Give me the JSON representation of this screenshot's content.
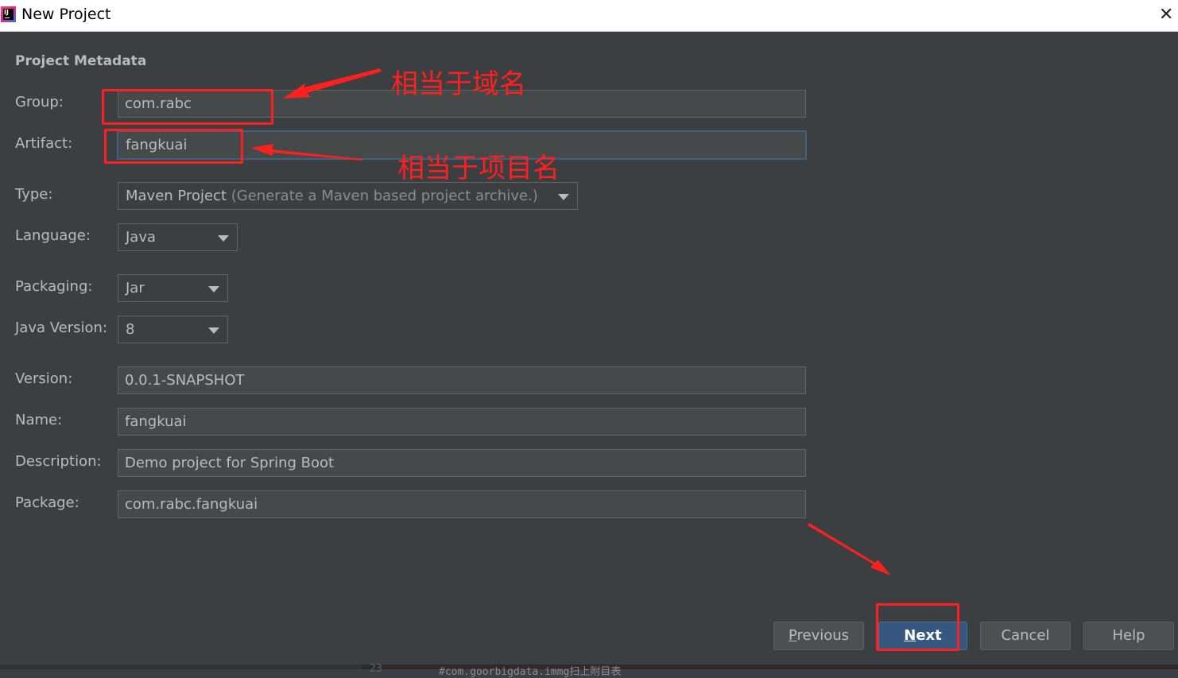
{
  "window": {
    "title": "New Project",
    "close_glyph": "✕",
    "app_icon": "intellij-idea-icon",
    "app_icon_letters": "IJ"
  },
  "section_title": "Project Metadata",
  "fields": {
    "group": {
      "label": "Group:",
      "value": "com.rabc"
    },
    "artifact": {
      "label": "Artifact:",
      "value": "fangkuai"
    },
    "type": {
      "label": "Type:",
      "value": "Maven Project",
      "description": "(Generate a Maven based project archive.)"
    },
    "language": {
      "label": "Language:",
      "value": "Java"
    },
    "packaging": {
      "label": "Packaging:",
      "value": "Jar"
    },
    "java_version": {
      "label": "Java Version:",
      "value": "8"
    },
    "version": {
      "label": "Version:",
      "value": "0.0.1-SNAPSHOT"
    },
    "name": {
      "label": "Name:",
      "value": "fangkuai"
    },
    "description": {
      "label": "Description:",
      "value": "Demo project for Spring Boot"
    },
    "package": {
      "label": "Package:",
      "value": "com.rabc.fangkuai"
    }
  },
  "buttons": {
    "previous": {
      "mnemonic": "P",
      "rest": "revious"
    },
    "next": {
      "mnemonic": "N",
      "rest": "ext"
    },
    "cancel": "Cancel",
    "help": "Help"
  },
  "annotations": {
    "group_note": "相当于域名",
    "artifact_note": "相当于项目名"
  },
  "background_editor": {
    "line_number": "23",
    "code_text": "#com.goorbigdata.immg扫上附目表"
  },
  "colors": {
    "dialog_bg": "#3c3f41",
    "field_bg": "#45494a",
    "text": "#bbbbbb",
    "primary_button": "#365880",
    "annotation_red": "#ff1f1f",
    "focus_border": "#3d6185"
  }
}
